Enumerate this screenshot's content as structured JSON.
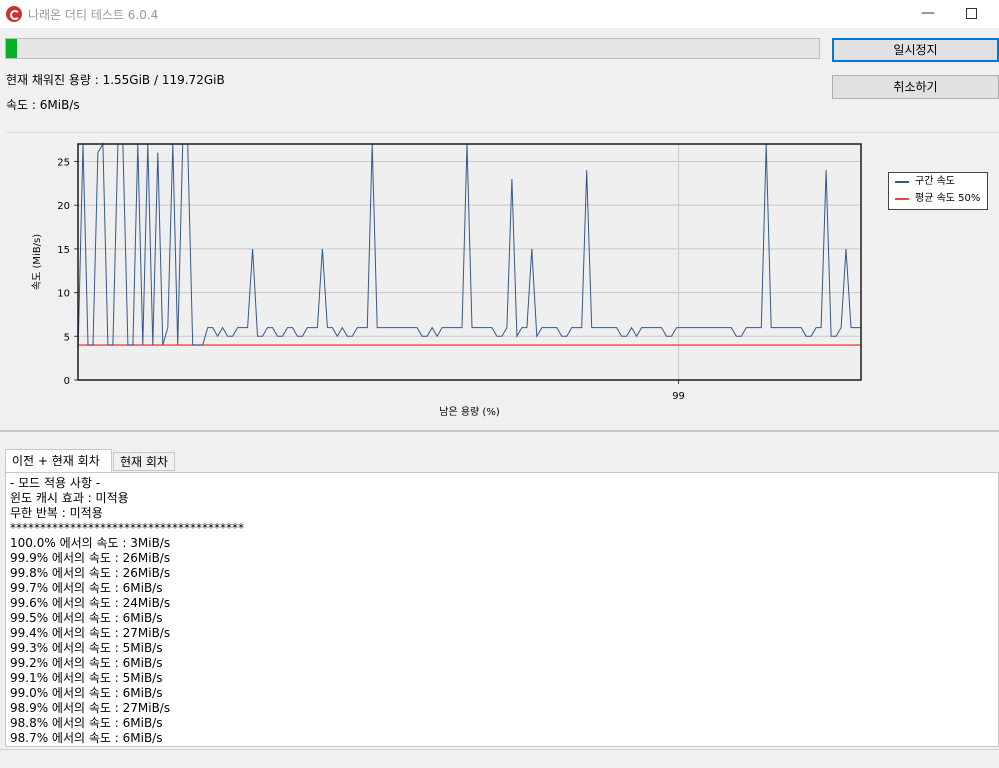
{
  "window": {
    "title": "나래온 더티 테스트 6.0.4",
    "minimize_glyph": "—",
    "maximize_icon": "maximize-icon"
  },
  "progress": {
    "fraction": 0.013,
    "color": "#06b025"
  },
  "buttons": {
    "pause_label": "일시정지",
    "cancel_label": "취소하기"
  },
  "status": {
    "capacity": "현재 채워진 용량 : 1.55GiB / 119.72GiB",
    "speed": "속도 : 6MiB/s"
  },
  "chart_data": {
    "type": "line",
    "xlabel": "남은 용량 (%)",
    "ylabel": "속도 (MiB/s)",
    "x_tick_labels": [
      "99"
    ],
    "y_ticks": [
      0,
      5,
      10,
      15,
      20,
      25
    ],
    "ylim": [
      0,
      27
    ],
    "grid": true,
    "legend_position": "right",
    "series": [
      {
        "name": "구간 속도",
        "color": "#35588c",
        "values": [
          3,
          27,
          4,
          4,
          26,
          27,
          4,
          4,
          27,
          27,
          4,
          4,
          27,
          4,
          27,
          4,
          26,
          4,
          6,
          27,
          4,
          27,
          27,
          4,
          4,
          4,
          6,
          6,
          5,
          6,
          5,
          5,
          6,
          6,
          6,
          15,
          5,
          5,
          6,
          6,
          5,
          5,
          6,
          6,
          5,
          5,
          6,
          6,
          6,
          15,
          6,
          6,
          5,
          6,
          5,
          5,
          6,
          6,
          6,
          27,
          6,
          6,
          6,
          6,
          6,
          6,
          6,
          6,
          6,
          5,
          5,
          6,
          5,
          6,
          6,
          6,
          6,
          6,
          27,
          6,
          6,
          6,
          6,
          6,
          5,
          5,
          6,
          23,
          5,
          6,
          6,
          15,
          5,
          6,
          6,
          6,
          6,
          5,
          5,
          6,
          6,
          6,
          24,
          6,
          6,
          6,
          6,
          6,
          6,
          5,
          5,
          6,
          5,
          6,
          6,
          6,
          6,
          6,
          5,
          5,
          6,
          6,
          6,
          6,
          6,
          6,
          6,
          6,
          6,
          6,
          6,
          6,
          5,
          5,
          6,
          6,
          6,
          6,
          27,
          6,
          6,
          6,
          6,
          6,
          6,
          6,
          5,
          5,
          6,
          6,
          24,
          5,
          5,
          6,
          15,
          6,
          6,
          6
        ]
      },
      {
        "name": "평균 속도 50%",
        "color": "#e8473c",
        "values": [
          4
        ]
      }
    ]
  },
  "tabs": {
    "previous_current": "이전 + 현재 회차",
    "current": "현재 회차"
  },
  "log": {
    "lines": [
      "- 모드 적용 사항 -",
      "윈도 캐시 효과 : 미적용",
      "무한 반복 : 미적용",
      "***************************************",
      "100.0% 에서의 속도 : 3MiB/s",
      "99.9% 에서의 속도 : 26MiB/s",
      "99.8% 에서의 속도 : 26MiB/s",
      "99.7% 에서의 속도 : 6MiB/s",
      "99.6% 에서의 속도 : 24MiB/s",
      "99.5% 에서의 속도 : 6MiB/s",
      "99.4% 에서의 속도 : 27MiB/s",
      "99.3% 에서의 속도 : 5MiB/s",
      "99.2% 에서의 속도 : 6MiB/s",
      "99.1% 에서의 속도 : 5MiB/s",
      "99.0% 에서의 속도 : 6MiB/s",
      "98.9% 에서의 속도 : 27MiB/s",
      "98.8% 에서의 속도 : 6MiB/s",
      "98.7% 에서의 속도 : 6MiB/s"
    ]
  }
}
